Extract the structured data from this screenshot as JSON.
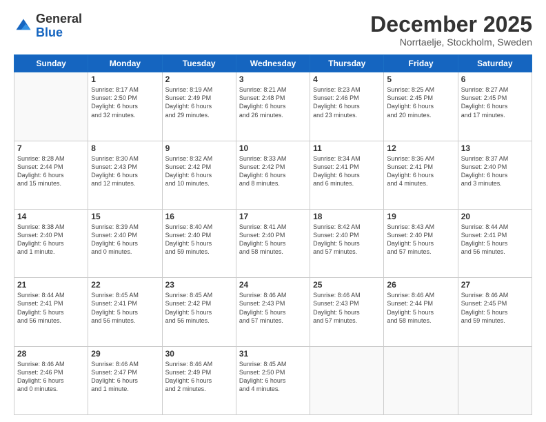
{
  "logo": {
    "general": "General",
    "blue": "Blue"
  },
  "header": {
    "title": "December 2025",
    "subtitle": "Norrtaelje, Stockholm, Sweden"
  },
  "days_of_week": [
    "Sunday",
    "Monday",
    "Tuesday",
    "Wednesday",
    "Thursday",
    "Friday",
    "Saturday"
  ],
  "weeks": [
    [
      {
        "day": "",
        "info": ""
      },
      {
        "day": "1",
        "info": "Sunrise: 8:17 AM\nSunset: 2:50 PM\nDaylight: 6 hours\nand 32 minutes."
      },
      {
        "day": "2",
        "info": "Sunrise: 8:19 AM\nSunset: 2:49 PM\nDaylight: 6 hours\nand 29 minutes."
      },
      {
        "day": "3",
        "info": "Sunrise: 8:21 AM\nSunset: 2:48 PM\nDaylight: 6 hours\nand 26 minutes."
      },
      {
        "day": "4",
        "info": "Sunrise: 8:23 AM\nSunset: 2:46 PM\nDaylight: 6 hours\nand 23 minutes."
      },
      {
        "day": "5",
        "info": "Sunrise: 8:25 AM\nSunset: 2:45 PM\nDaylight: 6 hours\nand 20 minutes."
      },
      {
        "day": "6",
        "info": "Sunrise: 8:27 AM\nSunset: 2:45 PM\nDaylight: 6 hours\nand 17 minutes."
      }
    ],
    [
      {
        "day": "7",
        "info": "Sunrise: 8:28 AM\nSunset: 2:44 PM\nDaylight: 6 hours\nand 15 minutes."
      },
      {
        "day": "8",
        "info": "Sunrise: 8:30 AM\nSunset: 2:43 PM\nDaylight: 6 hours\nand 12 minutes."
      },
      {
        "day": "9",
        "info": "Sunrise: 8:32 AM\nSunset: 2:42 PM\nDaylight: 6 hours\nand 10 minutes."
      },
      {
        "day": "10",
        "info": "Sunrise: 8:33 AM\nSunset: 2:42 PM\nDaylight: 6 hours\nand 8 minutes."
      },
      {
        "day": "11",
        "info": "Sunrise: 8:34 AM\nSunset: 2:41 PM\nDaylight: 6 hours\nand 6 minutes."
      },
      {
        "day": "12",
        "info": "Sunrise: 8:36 AM\nSunset: 2:41 PM\nDaylight: 6 hours\nand 4 minutes."
      },
      {
        "day": "13",
        "info": "Sunrise: 8:37 AM\nSunset: 2:40 PM\nDaylight: 6 hours\nand 3 minutes."
      }
    ],
    [
      {
        "day": "14",
        "info": "Sunrise: 8:38 AM\nSunset: 2:40 PM\nDaylight: 6 hours\nand 1 minute."
      },
      {
        "day": "15",
        "info": "Sunrise: 8:39 AM\nSunset: 2:40 PM\nDaylight: 6 hours\nand 0 minutes."
      },
      {
        "day": "16",
        "info": "Sunrise: 8:40 AM\nSunset: 2:40 PM\nDaylight: 5 hours\nand 59 minutes."
      },
      {
        "day": "17",
        "info": "Sunrise: 8:41 AM\nSunset: 2:40 PM\nDaylight: 5 hours\nand 58 minutes."
      },
      {
        "day": "18",
        "info": "Sunrise: 8:42 AM\nSunset: 2:40 PM\nDaylight: 5 hours\nand 57 minutes."
      },
      {
        "day": "19",
        "info": "Sunrise: 8:43 AM\nSunset: 2:40 PM\nDaylight: 5 hours\nand 57 minutes."
      },
      {
        "day": "20",
        "info": "Sunrise: 8:44 AM\nSunset: 2:41 PM\nDaylight: 5 hours\nand 56 minutes."
      }
    ],
    [
      {
        "day": "21",
        "info": "Sunrise: 8:44 AM\nSunset: 2:41 PM\nDaylight: 5 hours\nand 56 minutes."
      },
      {
        "day": "22",
        "info": "Sunrise: 8:45 AM\nSunset: 2:41 PM\nDaylight: 5 hours\nand 56 minutes."
      },
      {
        "day": "23",
        "info": "Sunrise: 8:45 AM\nSunset: 2:42 PM\nDaylight: 5 hours\nand 56 minutes."
      },
      {
        "day": "24",
        "info": "Sunrise: 8:46 AM\nSunset: 2:43 PM\nDaylight: 5 hours\nand 57 minutes."
      },
      {
        "day": "25",
        "info": "Sunrise: 8:46 AM\nSunset: 2:43 PM\nDaylight: 5 hours\nand 57 minutes."
      },
      {
        "day": "26",
        "info": "Sunrise: 8:46 AM\nSunset: 2:44 PM\nDaylight: 5 hours\nand 58 minutes."
      },
      {
        "day": "27",
        "info": "Sunrise: 8:46 AM\nSunset: 2:45 PM\nDaylight: 5 hours\nand 59 minutes."
      }
    ],
    [
      {
        "day": "28",
        "info": "Sunrise: 8:46 AM\nSunset: 2:46 PM\nDaylight: 6 hours\nand 0 minutes."
      },
      {
        "day": "29",
        "info": "Sunrise: 8:46 AM\nSunset: 2:47 PM\nDaylight: 6 hours\nand 1 minute."
      },
      {
        "day": "30",
        "info": "Sunrise: 8:46 AM\nSunset: 2:49 PM\nDaylight: 6 hours\nand 2 minutes."
      },
      {
        "day": "31",
        "info": "Sunrise: 8:45 AM\nSunset: 2:50 PM\nDaylight: 6 hours\nand 4 minutes."
      },
      {
        "day": "",
        "info": ""
      },
      {
        "day": "",
        "info": ""
      },
      {
        "day": "",
        "info": ""
      }
    ]
  ]
}
